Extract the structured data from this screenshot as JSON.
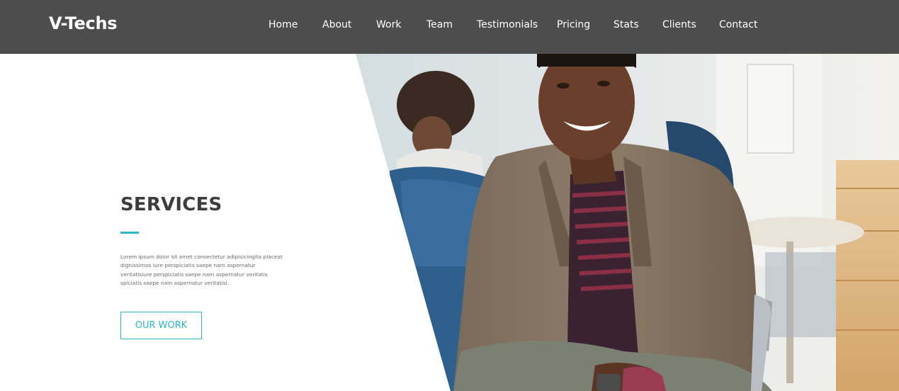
{
  "header": {
    "brand": "V-Techs",
    "nav": [
      {
        "label": "Home"
      },
      {
        "label": "About"
      },
      {
        "label": "Work"
      },
      {
        "label": "Team"
      },
      {
        "label": "Testimonials"
      },
      {
        "label": "Pricing"
      },
      {
        "label": "Stats"
      },
      {
        "label": "Clients"
      },
      {
        "label": "Contact"
      }
    ]
  },
  "hero": {
    "title": "SERVICES",
    "text": "Lorem ipsum dolor sit amet consectetur adipisicingita placeat dignissimos iure perspiciatis saepe nam aspernatur veritatisiure perspiciatis saepe nam aspernatur veritatis spiciatis saepe nam aspernatur veritatisi.",
    "button_label": "OUR WORK"
  },
  "colors": {
    "navbar": "#4d4d4d",
    "accent": "#2fb5cc",
    "title": "#3d3d3d"
  }
}
